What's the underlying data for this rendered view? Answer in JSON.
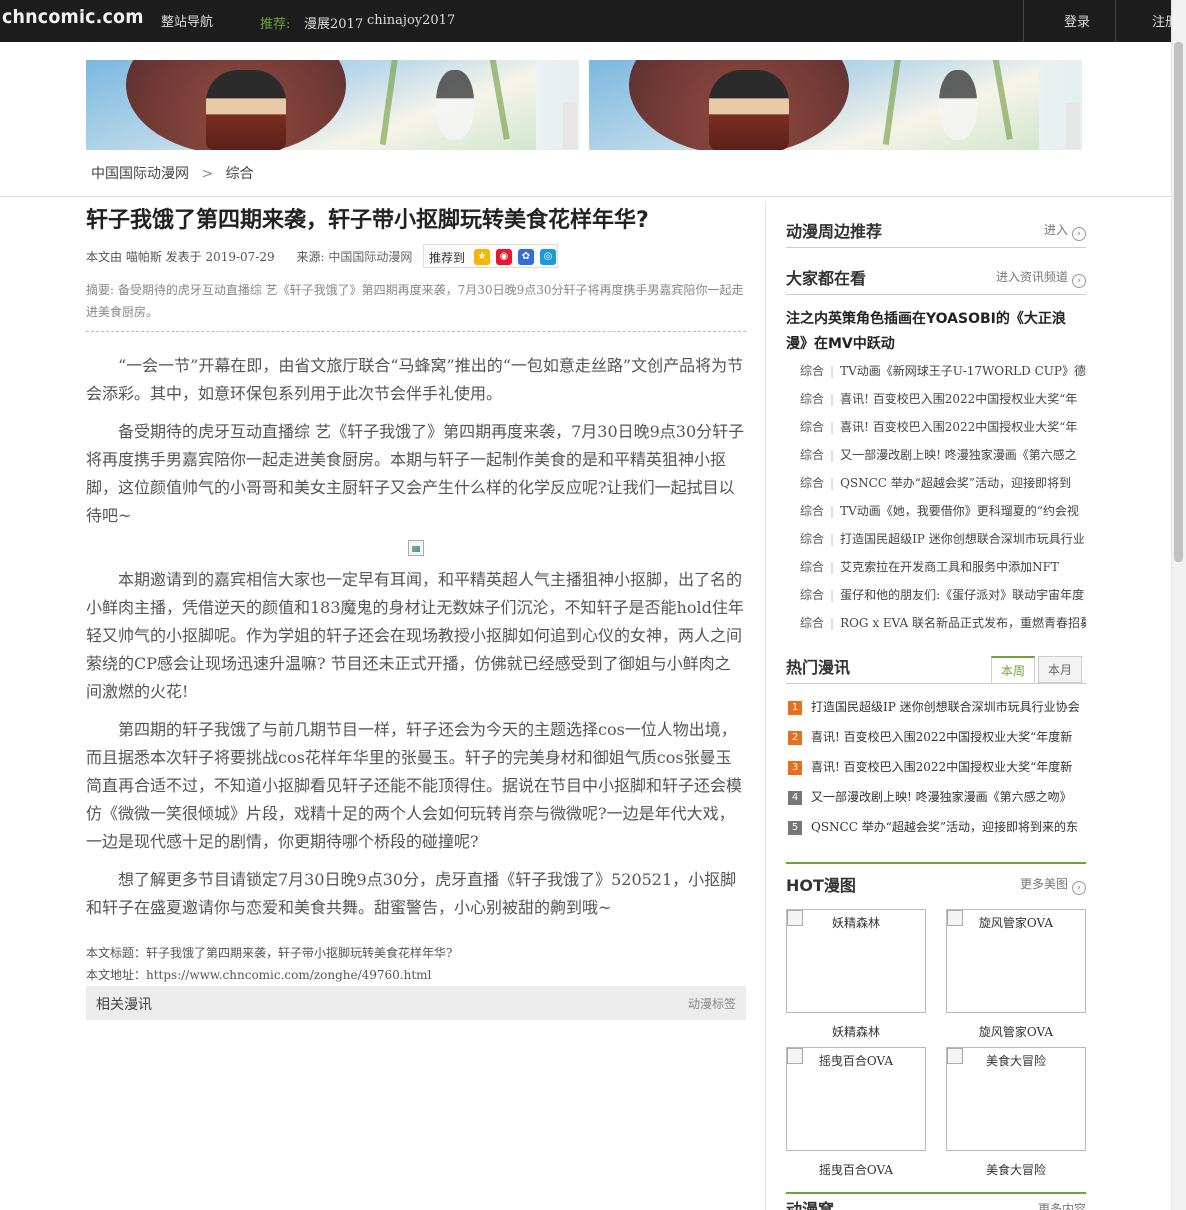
{
  "topbar": {
    "logo": "chncomic.com",
    "nav_site": "整站导航",
    "rec_label": "推荐:",
    "rec_items": [
      "漫展2017",
      "chinajoy2017"
    ],
    "login": "登录",
    "register": "注册"
  },
  "breadcrumb": {
    "home": "中国国际动漫网",
    "sep": ">",
    "current": "综合"
  },
  "article": {
    "title": "轩子我饿了第四期来袭，轩子带小抠脚玩转美食花样年华?",
    "meta_author": "本文由 喵帕斯 发表于 2019-07-29",
    "meta_source_label": "来源:",
    "meta_source": "中国国际动漫网",
    "share_label": "推荐到",
    "summary": "摘要:  备受期待的虎牙互动直播综 艺《轩子我饿了》第四期再度来袭，7月30日晚9点30分轩子将再度携手男嘉宾陪你一起走进美食厨房。",
    "paragraphs": [
      "“一会一节”开幕在即，由省文旅厅联合“马蜂窝”推出的“一包如意走丝路”文创产品将为节会添彩。其中，如意环保包系列用于此次节会伴手礼使用。",
      "备受期待的虎牙互动直播综 艺《轩子我饿了》第四期再度来袭，7月30日晚9点30分轩子将再度携手男嘉宾陪你一起走进美食厨房。本期与轩子一起制作美食的是和平精英狙神小抠脚，这位颜值帅气的小哥哥和美女主厨轩子又会产生什么样的化学反应呢?让我们一起拭目以待吧~",
      "本期邀请到的嘉宾相信大家也一定早有耳闻，和平精英超人气主播狙神小抠脚，出了名的小鲜肉主播，凭借逆天的颜值和183魔鬼的身材让无数妹子们沉沦，不知轩子是否能hold住年轻又帅气的小抠脚呢。作为学姐的轩子还会在现场教授小抠脚如何追到心仪的女神，两人之间萦绕的CP感会让现场迅速升温嘛? 节目还未正式开播，仿佛就已经感受到了御姐与小鲜肉之间激燃的火花!",
      "第四期的轩子我饿了与前几期节目一样，轩子还会为今天的主题选择cos一位人物出境，而且据悉本次轩子将要挑战cos花样年华里的张曼玉。轩子的完美身材和御姐气质cos张曼玉简直再合适不过，不知道小抠脚看见轩子还能不能顶得住。据说在节目中小抠脚和轩子还会模仿《微微一笑很倾城》片段，戏精十足的两个人会如何玩转肖奈与微微呢?一边是年代大戏，一边是现代感十足的剧情，你更期待哪个桥段的碰撞呢?",
      "想了解更多节目请锁定7月30日晚9点30分，虎牙直播《轩子我饿了》520521，小抠脚和轩子在盛夏邀请你与恋爱和美食共舞。甜蜜警告，小心别被甜的齁到哦~"
    ],
    "foot_title": "本文标题：轩子我饿了第四期来袭，轩子带小抠脚玩转美食花样年华?",
    "foot_url": "本文地址：https://www.chncomic.com/zonghe/49760.html",
    "related_label": "相关漫讯",
    "tags_label": "动漫标签"
  },
  "sidebar": {
    "peripheral": {
      "title": "动漫周边推荐",
      "more": "进入"
    },
    "popular": {
      "title": "大家都在看",
      "more": "进入资讯频道",
      "lead": "注之内英策角色插画在YOASOBI的《大正浪漫》在MV中跃动",
      "items": [
        {
          "cat": "综合",
          "text": "TV动画《新网球王子U-17WORLD CUP》德"
        },
        {
          "cat": "综合",
          "text": "喜讯! 百变校巴入围2022中国授权业大奖“年"
        },
        {
          "cat": "综合",
          "text": "喜讯! 百变校巴入围2022中国授权业大奖“年"
        },
        {
          "cat": "综合",
          "text": "又一部漫改剧上映! 咚漫独家漫画《第六感之"
        },
        {
          "cat": "综合",
          "text": "QSNCC 举办“超越会奖”活动，迎接即将到"
        },
        {
          "cat": "综合",
          "text": "TV动画《她，我要借你》更科瑠夏的“约会视"
        },
        {
          "cat": "综合",
          "text": "打造国民超级IP 迷你创想联合深圳市玩具行业"
        },
        {
          "cat": "综合",
          "text": "艾克索拉在开发商工具和服务中添加NFT"
        },
        {
          "cat": "综合",
          "text": "蛋仔和他的朋友们:《蛋仔派对》联动宇宙年度"
        },
        {
          "cat": "综合",
          "text": "ROG x EVA 联名新品正式发布，重燃青春招募"
        }
      ]
    },
    "hot": {
      "title": "热门漫讯",
      "tab_week": "本周",
      "tab_month": "本月",
      "items": [
        {
          "n": "1",
          "text": "打造国民超级IP 迷你创想联合深圳市玩具行业协会"
        },
        {
          "n": "2",
          "text": "喜讯! 百变校巴入围2022中国授权业大奖“年度新"
        },
        {
          "n": "3",
          "text": "喜讯! 百变校巴入围2022中国授权业大奖“年度新"
        },
        {
          "n": "4",
          "text": "又一部漫改剧上映! 咚漫独家漫画《第六感之吻》"
        },
        {
          "n": "5",
          "text": "QSNCC 举办“超越会奖”活动，迎接即将到来的东"
        }
      ],
      "rank_colors": [
        "#e8701d",
        "#e8701d",
        "#e8701d",
        "#777777",
        "#777777"
      ]
    },
    "hotpics": {
      "title": "HOT漫图",
      "more": "更多美图",
      "items": [
        "妖精森林",
        "旋风管家OVA",
        "摇曳百合OVA",
        "美食大冒险"
      ]
    },
    "next_section": {
      "title": "动漫窝",
      "more": "更多内容"
    }
  },
  "colors": {
    "accent": "#6fa23a",
    "topbar": "#1d1d1d",
    "rank_hot": "#e8701d"
  }
}
